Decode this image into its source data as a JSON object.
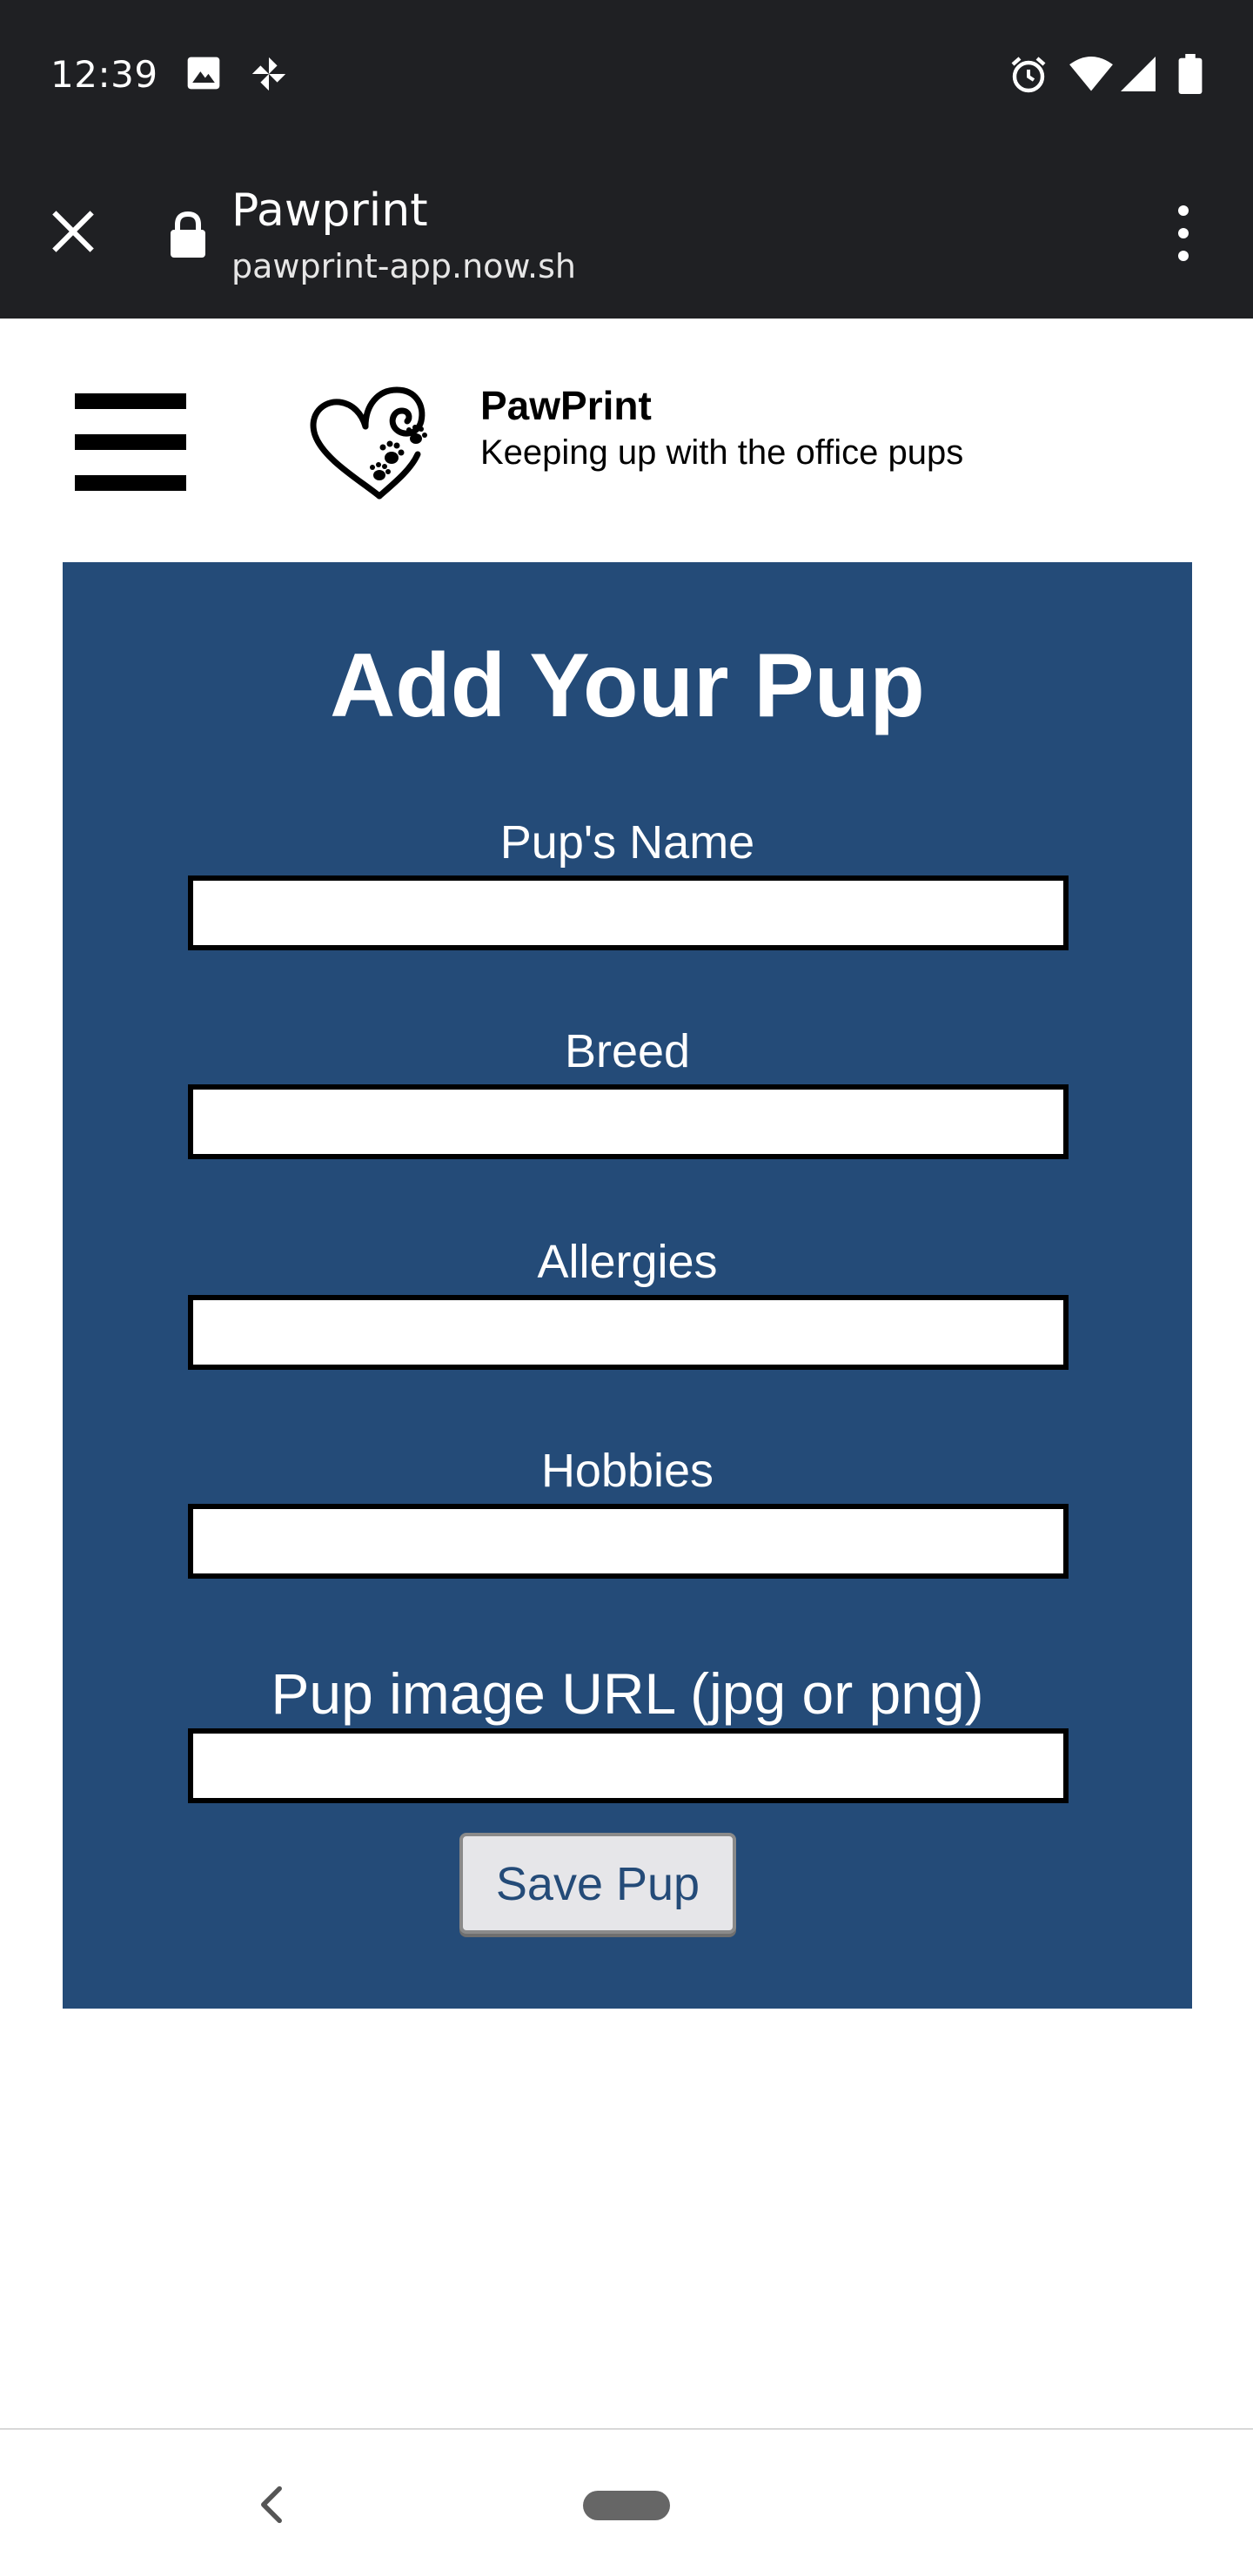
{
  "status_bar": {
    "time": "12:39",
    "icons_left": [
      "image-icon",
      "pinwheel-icon"
    ],
    "icons_right": [
      "alarm-icon",
      "wifi-icon",
      "signal-icon",
      "battery-icon"
    ]
  },
  "browser": {
    "page_title": "Pawprint",
    "url": "pawprint-app.now.sh",
    "icons": [
      "close-icon",
      "lock-icon",
      "more-vert-icon"
    ]
  },
  "header": {
    "brand_name": "PawPrint",
    "tagline": "Keeping up with the office pups",
    "icons": [
      "hamburger-menu-icon",
      "heart-paw-logo"
    ]
  },
  "form": {
    "title": "Add Your Pup",
    "fields": [
      {
        "label": "Pup's Name",
        "value": ""
      },
      {
        "label": "Breed",
        "value": ""
      },
      {
        "label": "Allergies",
        "value": ""
      },
      {
        "label": "Hobbies",
        "value": ""
      },
      {
        "label": "Pup image URL (jpg or png)",
        "value": ""
      }
    ],
    "submit_label": "Save Pup"
  },
  "colors": {
    "form_background": "#244b78",
    "system_bar": "#1f2023",
    "button_text": "#244b78"
  },
  "nav_bar": {
    "icons": [
      "back-icon",
      "home-pill"
    ]
  }
}
